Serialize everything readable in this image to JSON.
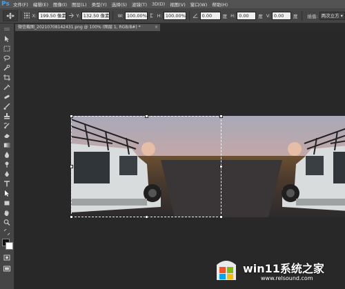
{
  "app": {
    "logo": "Ps"
  },
  "menu": [
    "文件(F)",
    "编辑(E)",
    "图像(I)",
    "图层(L)",
    "类型(Y)",
    "选择(S)",
    "滤镜(T)",
    "3D(D)",
    "视图(V)",
    "窗口(W)",
    "帮助(H)"
  ],
  "options": {
    "x_label": "X:",
    "x_value": "199.50 像素",
    "y_label": "Y:",
    "y_value": "132.50 像素",
    "w_label": "W:",
    "w_value": "100.00%",
    "h_label": "H:",
    "h_value": "100.00%",
    "angle_value": "0.00",
    "angle_unit": "度",
    "h_skew_label": "H:",
    "h_skew_value": "0.00",
    "h_skew_unit": "度",
    "v_skew_label": "V:",
    "v_skew_value": "0.00",
    "v_skew_unit": "度",
    "interp_label": "插值:",
    "interp_value": "两次立方"
  },
  "document": {
    "tab_title": "微信截图_20210708142431.png @ 100% (图层 1, RGB/8#) *",
    "close": "×"
  },
  "tools": [
    "move-tool",
    "marquee-tool",
    "lasso-tool",
    "quick-select-tool",
    "crop-tool",
    "eyedropper-tool",
    "healing-brush-tool",
    "brush-tool",
    "clone-stamp-tool",
    "history-brush-tool",
    "eraser-tool",
    "gradient-tool",
    "blur-tool",
    "dodge-tool",
    "pen-tool",
    "type-tool",
    "path-select-tool",
    "shape-tool",
    "hand-tool",
    "zoom-tool"
  ],
  "watermark": {
    "title": "win11系统之家",
    "url": "www.relsound.com"
  }
}
